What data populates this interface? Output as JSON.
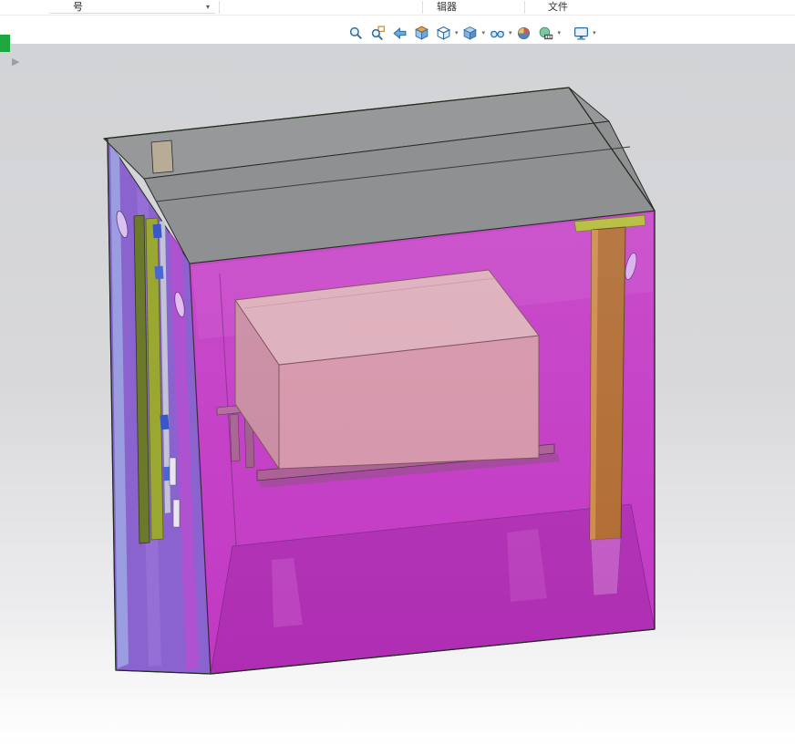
{
  "topbar": {
    "combo": {
      "label": "号",
      "caret": "▾"
    },
    "groups": [
      {
        "label": "辑器"
      },
      {
        "label": "文件"
      }
    ]
  },
  "toolbar": {
    "caret": "▾",
    "icons": [
      {
        "name": "zoom-to-fit"
      },
      {
        "name": "zoom-to-area"
      },
      {
        "name": "previous-view"
      },
      {
        "name": "section-view"
      },
      {
        "name": "view-orientation",
        "has_dropdown": true
      },
      {
        "name": "display-style",
        "has_dropdown": true
      },
      {
        "name": "hide-show-items",
        "has_dropdown": true
      },
      {
        "name": "edit-appearance"
      },
      {
        "name": "apply-scene",
        "has_dropdown": true
      },
      {
        "name": "view-settings",
        "has_dropdown": true
      }
    ]
  },
  "sidebar": {
    "flyout_arrow": "▶",
    "green_tab_color": "#1ea73e"
  },
  "viewport": {
    "model": {
      "name": "enclosure-assembly",
      "colors": {
        "lid_gray": "#97989a",
        "lid_gray_front": "#8f9092",
        "front_glass_magenta": "#c238c4",
        "left_wall_purple": "#8a63cf",
        "inner_box_pink": "#d493a8",
        "inner_box_top_pink": "#dcacb9",
        "pcb_green": "#9aa832",
        "bar_orange": "#b06a30",
        "floor_magenta": "#ae2cb2",
        "edge_color": "#1f2e1f"
      },
      "background_top": "#d2d3d6",
      "background_bottom": "#ffffff"
    }
  }
}
